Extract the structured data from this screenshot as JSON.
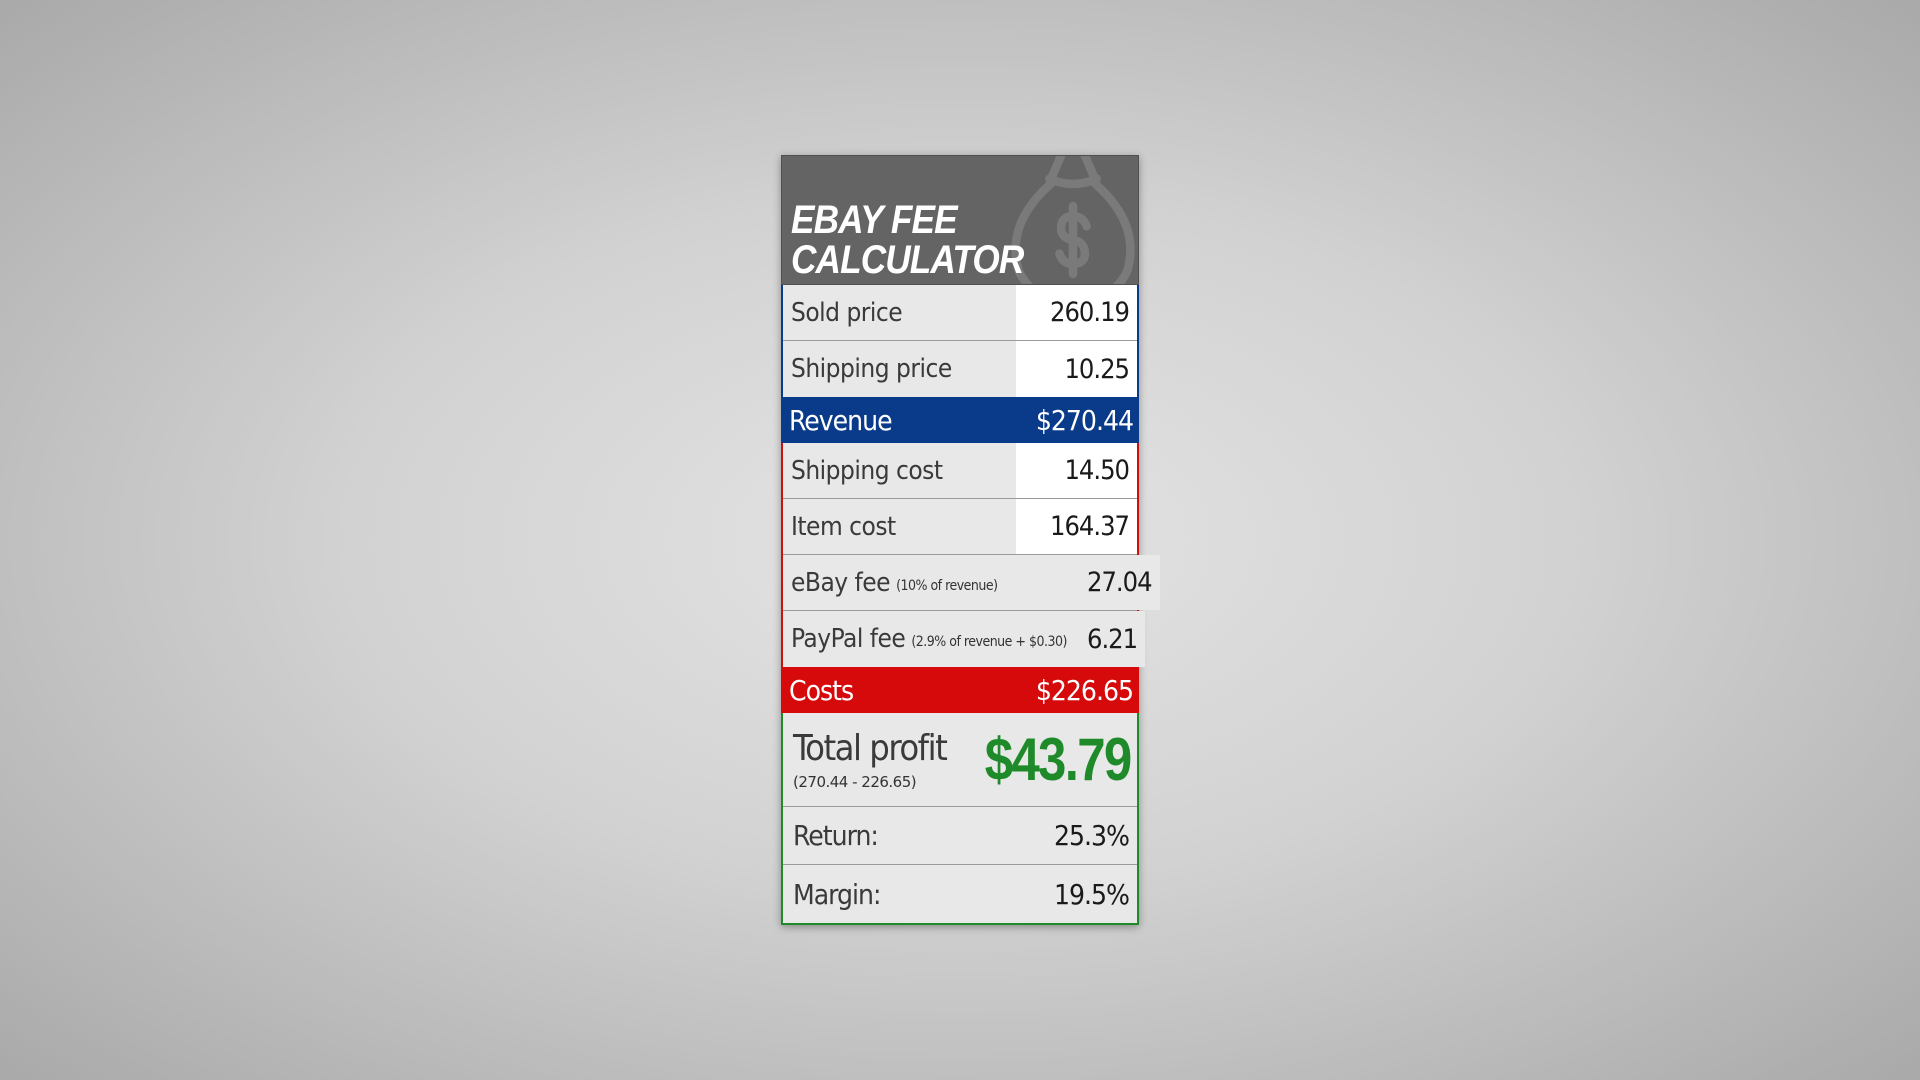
{
  "header": {
    "title_line1": "EBAY FEE",
    "title_line2": "CALCULATOR",
    "icon": "money-bag-icon"
  },
  "inputs": {
    "sold_price": {
      "label": "Sold price",
      "value": "260.19"
    },
    "shipping_price": {
      "label": "Shipping price",
      "value": "10.25"
    }
  },
  "revenue": {
    "label": "Revenue",
    "value": "$270.44"
  },
  "costs_items": {
    "shipping_cost": {
      "label": "Shipping cost",
      "value": "14.50"
    },
    "item_cost": {
      "label": "Item cost",
      "value": "164.37"
    },
    "ebay_fee": {
      "label": "eBay fee",
      "note": "(10% of revenue)",
      "value": "27.04"
    },
    "paypal_fee": {
      "label": "PayPal fee",
      "note": "(2.9% of revenue + $0.30)",
      "value": "6.21"
    }
  },
  "costs": {
    "label": "Costs",
    "value": "$226.65"
  },
  "profit": {
    "label": "Total profit",
    "formula": "(270.44 - 226.65)",
    "value": "$43.79"
  },
  "stats": {
    "return": {
      "label": "Return:",
      "value": "25.3%"
    },
    "margin": {
      "label": "Margin:",
      "value": "19.5%"
    }
  },
  "colors": {
    "revenue": "#0a3a8a",
    "costs": "#d60a0a",
    "profit": "#1f8a2a",
    "header": "#646464"
  }
}
